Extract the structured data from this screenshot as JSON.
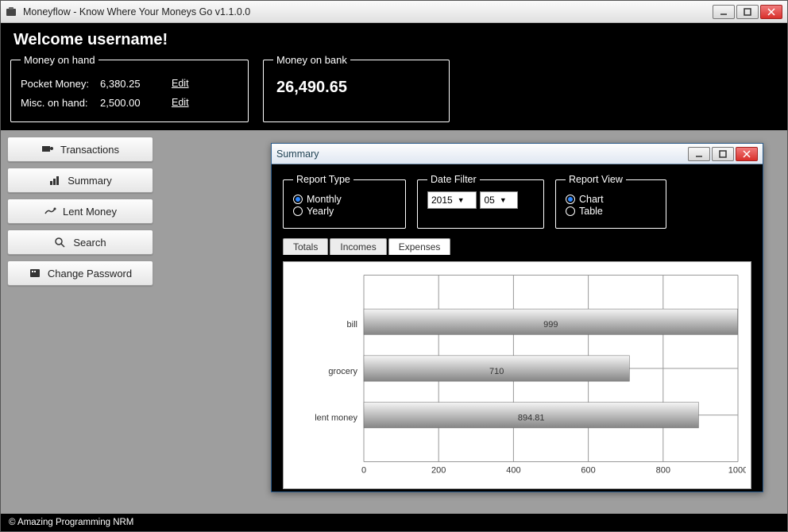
{
  "window": {
    "title": "Moneyflow - Know Where Your Moneys Go v1.1.0.0"
  },
  "header": {
    "welcome": "Welcome username!"
  },
  "money_on_hand": {
    "legend": "Money on hand",
    "pocket_label": "Pocket Money:",
    "pocket_value": "6,380.25",
    "misc_label": "Misc. on hand:",
    "misc_value": "2,500.00",
    "edit_label": "Edit"
  },
  "money_on_bank": {
    "legend": "Money on bank",
    "value": "26,490.65"
  },
  "sidebar": {
    "items": [
      {
        "label": "Transactions",
        "icon": "transactions-icon"
      },
      {
        "label": "Summary",
        "icon": "summary-icon"
      },
      {
        "label": "Lent Money",
        "icon": "lent-money-icon"
      },
      {
        "label": "Search",
        "icon": "search-icon"
      },
      {
        "label": "Change Password",
        "icon": "password-icon"
      }
    ]
  },
  "footer": {
    "text": "© Amazing Programming NRM"
  },
  "summary_window": {
    "title": "Summary",
    "report_type": {
      "legend": "Report Type",
      "monthly": "Monthly",
      "yearly": "Yearly",
      "selected": "Monthly"
    },
    "date_filter": {
      "legend": "Date Filter",
      "year": "2015",
      "month": "05"
    },
    "report_view": {
      "legend": "Report View",
      "chart": "Chart",
      "table": "Table",
      "selected": "Chart"
    },
    "tabs": {
      "totals": "Totals",
      "incomes": "Incomes",
      "expenses": "Expenses",
      "active": "Expenses"
    }
  },
  "chart_data": {
    "type": "bar",
    "orientation": "horizontal",
    "categories": [
      "bill",
      "grocery",
      "lent money"
    ],
    "values": [
      999,
      710,
      894.81
    ],
    "xlabel": "",
    "ylabel": "",
    "xlim": [
      0,
      1000
    ],
    "xticks": [
      0,
      200,
      400,
      600,
      800,
      1000
    ]
  }
}
